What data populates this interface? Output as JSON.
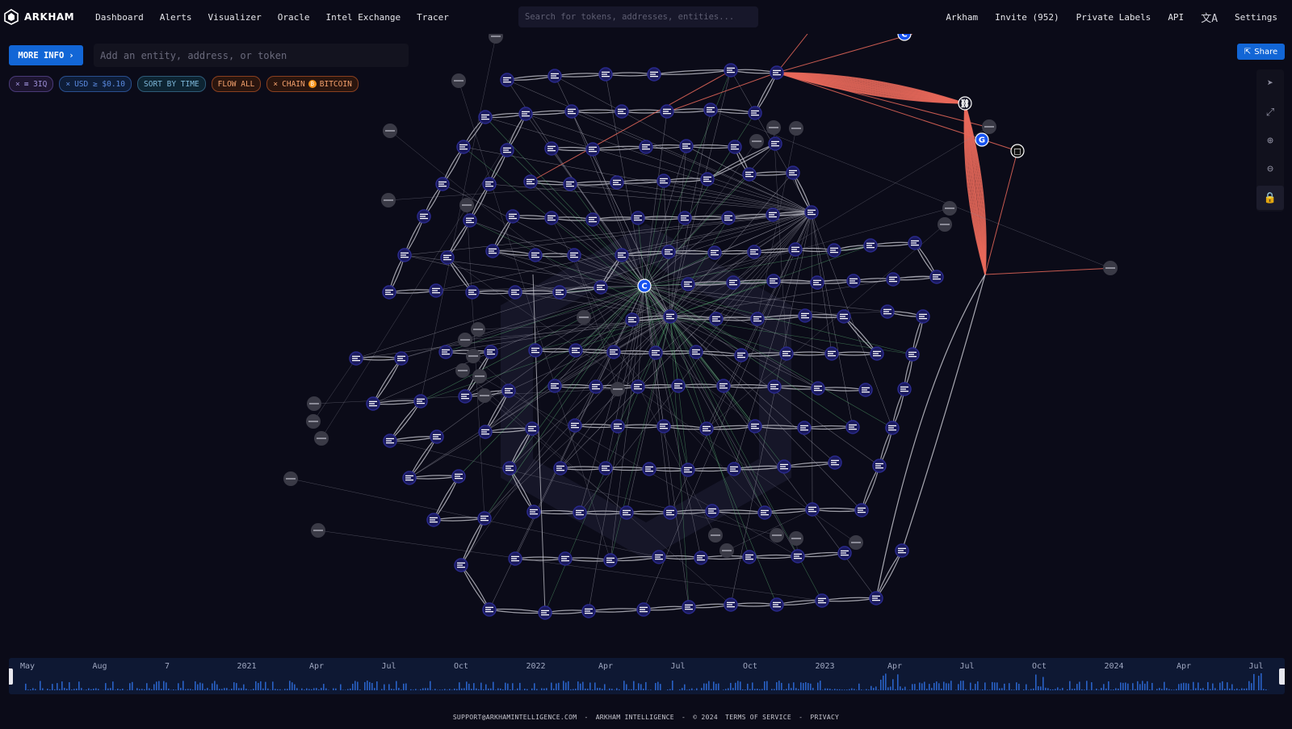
{
  "brand": {
    "name": "ARKHAM"
  },
  "nav": {
    "items": [
      "Dashboard",
      "Alerts",
      "Visualizer",
      "Oracle",
      "Intel Exchange",
      "Tracer"
    ]
  },
  "search": {
    "placeholder": "Search for tokens, addresses, entities..."
  },
  "right_nav": {
    "items": [
      "Arkham",
      "Invite (952)",
      "Private Labels",
      "API"
    ],
    "translate_icon": "translate-icon",
    "settings": "Settings"
  },
  "toolbar": {
    "more_info": "MORE INFO",
    "more_info_icon": "chevron-right-icon",
    "entity_placeholder": "Add an entity, address, or token",
    "share": "Share",
    "share_icon": "share-icon"
  },
  "filters": {
    "token": "≡ 3IQ",
    "usd": "USD ≥ $0.10",
    "sort": "SORT BY TIME",
    "flow": "FLOW ALL",
    "chain_label": "CHAIN",
    "chain_value": "BITCOIN",
    "remove_icon": "close-icon"
  },
  "graph_tools": [
    "pointer-icon",
    "fit-screen-icon",
    "zoom-in-icon",
    "zoom-out-icon",
    "lock-icon"
  ],
  "timeline": {
    "labels": [
      "May",
      "Aug",
      "7",
      "2021",
      "Apr",
      "Jul",
      "Oct",
      "2022",
      "Apr",
      "Jul",
      "Oct",
      "2023",
      "Apr",
      "Jul",
      "Oct",
      "2024",
      "Apr",
      "Jul"
    ]
  },
  "footer": {
    "support": "SUPPORT@ARKHAMINTELLIGENCE.COM",
    "company": "ARKHAM INTELLIGENCE",
    "copyright": "© 2024",
    "terms": "TERMS OF SERVICE",
    "privacy": "PRIVACY",
    "sep": "-"
  },
  "colors": {
    "accent": "#1266d6",
    "background": "#0b0b18",
    "node": "#1a1a5c",
    "outflow": "#e8685a",
    "inflow": "#5fb878",
    "edge": "#d0d0d8"
  }
}
